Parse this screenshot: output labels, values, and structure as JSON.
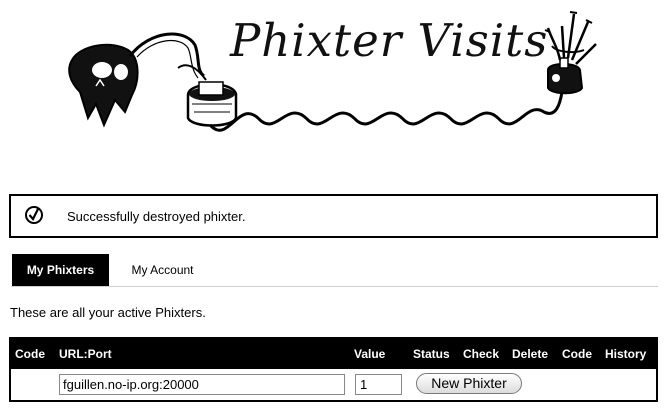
{
  "header": {
    "title": "Phixter Visits",
    "logo_icon": "phixter-creature-illustration"
  },
  "flash": {
    "icon": "check-circle-icon",
    "message": "Successfully destroyed phixter."
  },
  "tabs": [
    {
      "label": "My Phixters",
      "active": true
    },
    {
      "label": "My Account",
      "active": false
    }
  ],
  "intro": "These are all your active Phixters.",
  "table": {
    "columns": [
      "Code",
      "URL:Port",
      "Value",
      "Status",
      "Check",
      "Delete",
      "Code",
      "History"
    ],
    "new_row": {
      "url_value": "fguillen.no-ip.org:20000",
      "value": "1",
      "button_label": "New Phixter"
    }
  }
}
